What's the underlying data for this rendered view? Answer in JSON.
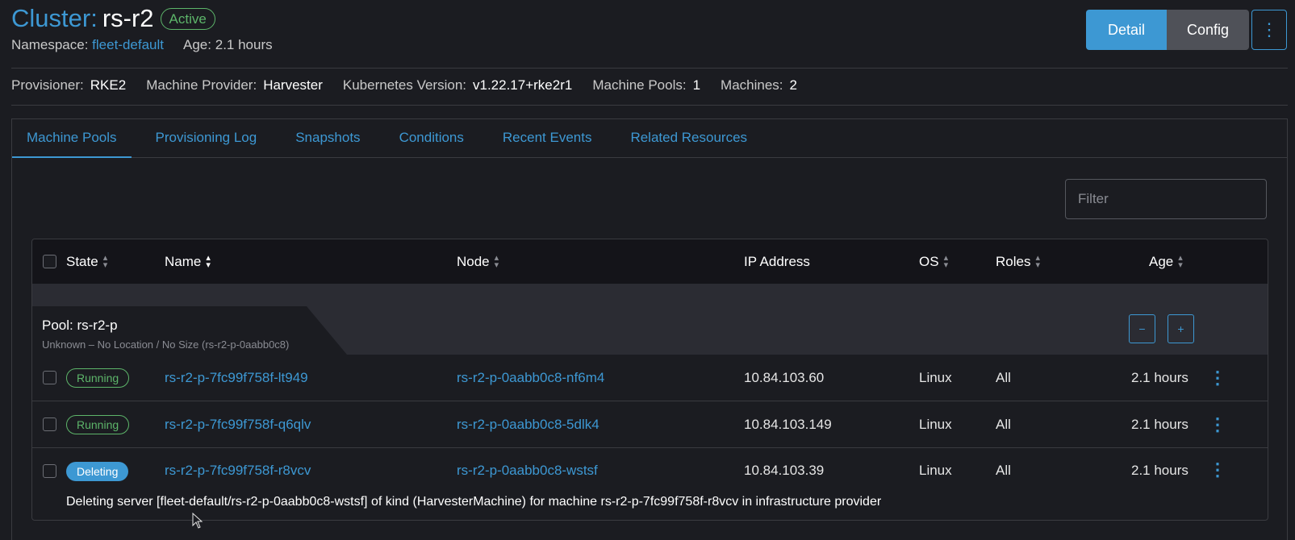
{
  "header": {
    "prefix": "Cluster:",
    "name": "rs-r2",
    "status": "Active",
    "namespace_label": "Namespace:",
    "namespace_value": "fleet-default",
    "age_label": "Age:",
    "age_value": "2.1 hours"
  },
  "toolbar": {
    "detail_label": "Detail",
    "config_label": "Config",
    "more_glyph": "⋮"
  },
  "meta": {
    "provisioner_label": "Provisioner:",
    "provisioner_value": "RKE2",
    "provider_label": "Machine Provider:",
    "provider_value": "Harvester",
    "k8s_label": "Kubernetes Version:",
    "k8s_value": "v1.22.17+rke2r1",
    "pools_label": "Machine Pools:",
    "pools_value": "1",
    "machines_label": "Machines:",
    "machines_value": "2"
  },
  "tabs": [
    {
      "label": "Machine Pools"
    },
    {
      "label": "Provisioning Log"
    },
    {
      "label": "Snapshots"
    },
    {
      "label": "Conditions"
    },
    {
      "label": "Recent Events"
    },
    {
      "label": "Related Resources"
    }
  ],
  "filter": {
    "placeholder": "Filter"
  },
  "table": {
    "columns": {
      "state": "State",
      "name": "Name",
      "node": "Node",
      "ip": "IP Address",
      "os": "OS",
      "roles": "Roles",
      "age": "Age"
    },
    "pool": {
      "title": "Pool: rs-r2-p",
      "subtitle": "Unknown – No Location / No Size (rs-r2-p-0aabb0c8)",
      "minus": "−",
      "plus": "+"
    },
    "rows": [
      {
        "state": "Running",
        "name": "rs-r2-p-7fc99f758f-lt949",
        "node": "rs-r2-p-0aabb0c8-nf6m4",
        "ip": "10.84.103.60",
        "os": "Linux",
        "roles": "All",
        "age": "2.1 hours"
      },
      {
        "state": "Running",
        "name": "rs-r2-p-7fc99f758f-q6qlv",
        "node": "rs-r2-p-0aabb0c8-5dlk4",
        "ip": "10.84.103.149",
        "os": "Linux",
        "roles": "All",
        "age": "2.1 hours"
      },
      {
        "state": "Deleting",
        "name": "rs-r2-p-7fc99f758f-r8vcv",
        "node": "rs-r2-p-0aabb0c8-wstsf",
        "ip": "10.84.103.39",
        "os": "Linux",
        "roles": "All",
        "age": "2.1 hours",
        "message": "Deleting server [fleet-default/rs-r2-p-0aabb0c8-wstsf] of kind (HarvesterMachine) for machine rs-r2-p-7fc99f758f-r8vcv in infrastructure provider"
      }
    ]
  },
  "colors": {
    "accent": "#3d98d3",
    "success": "#5db56a",
    "background": "#1b1c21"
  }
}
